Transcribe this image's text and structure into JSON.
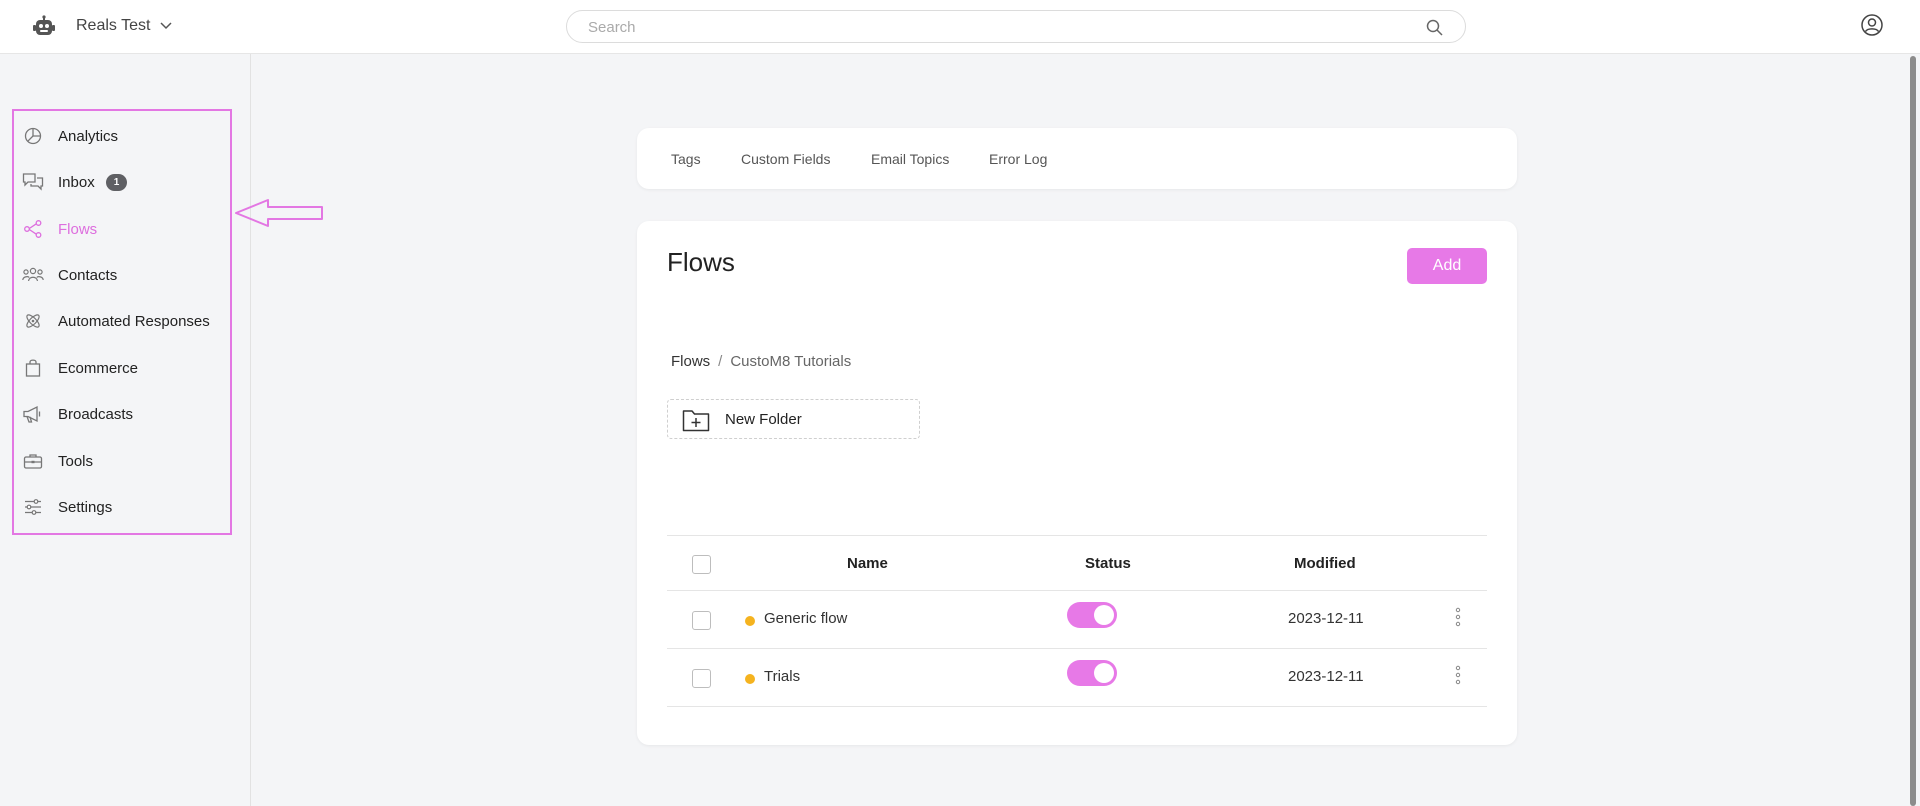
{
  "header": {
    "workspace_name": "Reals Test",
    "search_placeholder": "Search"
  },
  "sidebar": {
    "items": [
      {
        "label": "Analytics",
        "icon": "analytics-icon"
      },
      {
        "label": "Inbox",
        "icon": "inbox-icon",
        "badge": "1"
      },
      {
        "label": "Flows",
        "icon": "flows-icon",
        "active": true
      },
      {
        "label": "Contacts",
        "icon": "contacts-icon"
      },
      {
        "label": "Automated Responses",
        "icon": "automated-responses-icon"
      },
      {
        "label": "Ecommerce",
        "icon": "ecommerce-icon"
      },
      {
        "label": "Broadcasts",
        "icon": "broadcasts-icon"
      },
      {
        "label": "Tools",
        "icon": "tools-icon"
      },
      {
        "label": "Settings",
        "icon": "settings-icon"
      }
    ]
  },
  "tabs": [
    "Tags",
    "Custom Fields",
    "Email Topics",
    "Error Log"
  ],
  "main": {
    "title": "Flows",
    "add_label": "Add",
    "breadcrumb": {
      "root": "Flows",
      "separator": "/",
      "current": "CustoM8 Tutorials"
    },
    "new_folder_label": "New Folder"
  },
  "table": {
    "headers": {
      "name": "Name",
      "status": "Status",
      "modified": "Modified"
    },
    "rows": [
      {
        "name": "Generic flow",
        "status": "on",
        "modified": "2023-12-11",
        "status_color": "#f5b31f"
      },
      {
        "name": "Trials",
        "status": "on",
        "modified": "2023-12-11",
        "status_color": "#f5b31f"
      }
    ]
  },
  "colors": {
    "accent": "#e779e7",
    "active_nav": "#dd6ede",
    "annotation": "#e377e3",
    "status_dot": "#f5b31f",
    "badge": "#5f6064"
  }
}
